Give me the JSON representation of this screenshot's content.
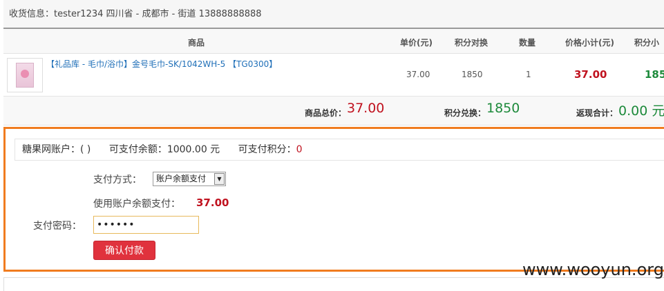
{
  "shipping": {
    "text": "收货信息：tester1234 四川省 - 成都市 - 街道 13888888888"
  },
  "table": {
    "headers": {
      "product": "商品",
      "unit_price": "单价(元)",
      "points_exchange": "积分对换",
      "quantity": "数量",
      "subtotal": "价格小计(元)",
      "points_subtotal": "积分小"
    },
    "rows": [
      {
        "product_name": "【礼品库 - 毛巾/浴巾】金号毛巾-SK/1042WH-5 【TG0300】",
        "unit_price": "37.00",
        "points": "1850",
        "quantity": "1",
        "subtotal": "37.00",
        "points_subtotal": "185"
      }
    ],
    "totals": {
      "goods_total_label": "商品总价：",
      "goods_total_value": "37.00",
      "points_label": "积分兑换：",
      "points_value": "1850",
      "rebate_label": "返现合计：",
      "rebate_value": "0.00 元"
    }
  },
  "payment": {
    "account_label": "糖果网账户：( )",
    "balance_label": "可支付余额：1000.00 元",
    "points_prefix": "可支付积分：",
    "points_value": "0",
    "method_label": "支付方式：",
    "method_selected": "账户余额支付",
    "use_balance_label": "使用账户余额支付：",
    "use_balance_value": "37.00",
    "password_label": "支付密码：",
    "password_value": "••••••",
    "confirm_button": "确认付款"
  },
  "watermark": "www.wooyun.org",
  "colors": {
    "highlight_border": "#f07c1f",
    "price_red": "#c0121f",
    "points_green": "#1d8a3b",
    "button_red": "#e0323d",
    "link_blue": "#1f6fb8"
  }
}
